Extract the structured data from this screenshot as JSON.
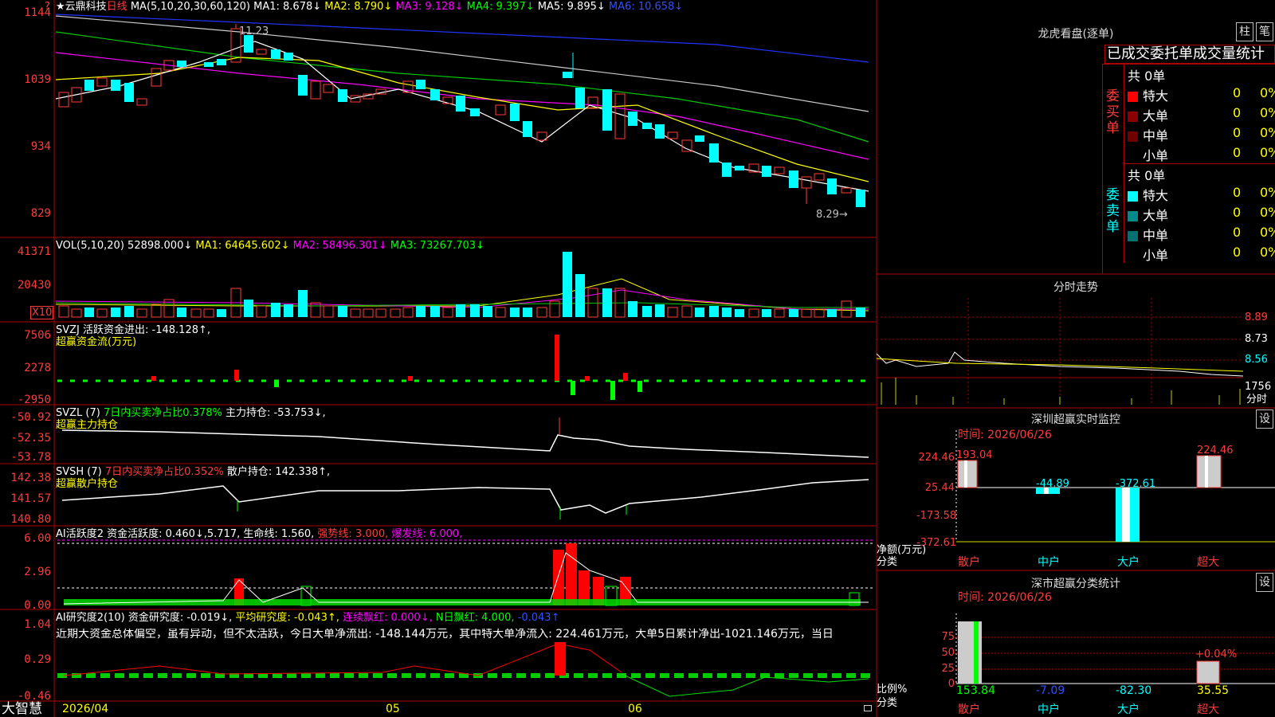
{
  "main_chart": {
    "star": "★",
    "stock_name": "云鼎科技",
    "period": "日线",
    "ma_label": "MA(5,10,20,30,60,120)",
    "ma1": "MA1: 8.678↓",
    "ma2": "MA2: 8.790↓",
    "ma3": "MA3: 9.128↓",
    "ma4": "MA4: 9.397↓",
    "ma5": "MA5: 9.895↓",
    "ma6": "MA6: 10.658↓",
    "y_ticks": [
      "1144",
      "1039",
      "934",
      "829"
    ],
    "high_label": "11.23",
    "low_label": "8.29→",
    "corner_mark": "?"
  },
  "vol_panel": {
    "label": "VOL(5,10,20)",
    "value": "52898.000↓",
    "ma1": "MA1: 64645.602↓",
    "ma2": "MA2: 58496.301↓",
    "ma3": "MA3: 73267.703↓",
    "y_ticks": [
      "41371",
      "20430"
    ],
    "unit": "X10"
  },
  "svzj_panel": {
    "label": "SVZJ",
    "text1": "活跃资金进出: -148.128↑,",
    "text2": "超赢资金流(万元)",
    "y_ticks": [
      "7506",
      "2278",
      "-2950"
    ]
  },
  "svzl_panel": {
    "label": "SVZL (7)",
    "text1": "7日内买卖净占比0.378%",
    "text2": "主力持仓: -53.753↓,",
    "text3": "超赢主力持仓",
    "y_ticks": [
      "-50.92",
      "-52.35",
      "-53.78"
    ]
  },
  "svsh_panel": {
    "label": "SVSH (7)",
    "text1": "7日内买卖净占比0.352%",
    "text2": "散户持仓: 142.338↑,",
    "text3": "超赢散户持仓",
    "y_ticks": [
      "142.38",
      "141.57",
      "140.80"
    ]
  },
  "ai_active_panel": {
    "label": "AI活跃度2",
    "text1": "资金活跃度: 0.460↓,5.717,",
    "text2": "生命线: 1.560,",
    "text3": "强势线: 3.000,",
    "text4": "爆发线: 6.000,",
    "y_ticks": [
      "6.00",
      "2.96",
      "0.00"
    ]
  },
  "ai_research_panel": {
    "label": "AI研究度2(10)",
    "text1": "资金研究度: -0.019↓,",
    "text2": "平均研究度: -0.043↑,",
    "text3": "连续飘红: 0.000↓,",
    "text4": "N日飘红: 4.000,",
    "text5": "-0.043↑",
    "comment": "近期大资金总体偏空，虽有异动，但不太活跃，今日大单净流出: -148.144万元，其中特大单净流入: 224.461万元，大单5日累计净出-1021.146万元，当日",
    "y_ticks": [
      "1.04",
      "0.29",
      "-0.46"
    ]
  },
  "bottom_bar": {
    "brand": "大智慧",
    "date_start": "2026/04",
    "m05": "05",
    "m06": "06"
  },
  "dragon_tiger": {
    "title": "龙虎看盘(逐单)",
    "btn1": "柱",
    "btn2": "笔",
    "subtitle": "已成交委托单成交量统计",
    "buy_side": "委买单",
    "sell_side": "委卖单",
    "buy_total": "共 0单",
    "sell_total": "共 0单",
    "buy_rows": [
      {
        "label": "特大",
        "n": "0",
        "pct": "0%",
        "color": "#ff0000"
      },
      {
        "label": "大单",
        "n": "0",
        "pct": "0%",
        "color": "#8b0000"
      },
      {
        "label": "中单",
        "n": "0",
        "pct": "0%",
        "color": "#700000"
      },
      {
        "label": "小单",
        "n": "0",
        "pct": "0%",
        "color": "#000000"
      }
    ],
    "sell_rows": [
      {
        "label": "特大",
        "n": "0",
        "pct": "0%",
        "color": "#00ffff"
      },
      {
        "label": "大单",
        "n": "0",
        "pct": "0%",
        "color": "#008b8b"
      },
      {
        "label": "中单",
        "n": "0",
        "pct": "0%",
        "color": "#007070"
      },
      {
        "label": "小单",
        "n": "0",
        "pct": "0%",
        "color": "#000000"
      }
    ]
  },
  "intraday": {
    "title": "分时走势",
    "y_ticks": [
      "8.89",
      "8.73",
      "8.56"
    ],
    "vol_tick": "1756",
    "unit": "分时"
  },
  "sz_monitor": {
    "title": "深圳超赢实时监控",
    "btn": "设",
    "time": "时间: 2026/06/26",
    "y_ticks": [
      "224.46",
      "25.44",
      "-173.58",
      "-372.61"
    ],
    "ylabel1": "净额(万元)",
    "ylabel2": "分类",
    "bars": [
      {
        "label": "散户",
        "value": "193.04"
      },
      {
        "label": "中户",
        "value": "-44.89"
      },
      {
        "label": "大户",
        "value": "-372.61"
      },
      {
        "label": "超大",
        "value": "224.46"
      }
    ]
  },
  "sz_class": {
    "title": "深市超赢分类统计",
    "btn": "设",
    "time": "时间: 2026/06/26",
    "y_ticks": [
      "75",
      "50",
      "25",
      "0"
    ],
    "ylabel1": "比例%",
    "ylabel2": "分类",
    "pct_label": "+0.04%",
    "bars": [
      {
        "label": "散户",
        "value": "153.84"
      },
      {
        "label": "中户",
        "value": "-7.09"
      },
      {
        "label": "大户",
        "value": "-82.30"
      },
      {
        "label": "超大",
        "value": "35.55"
      }
    ]
  },
  "colors": {
    "up": "#ff3b3b",
    "down": "#00ffff",
    "grid": "#b00000",
    "bg": "#000000"
  }
}
